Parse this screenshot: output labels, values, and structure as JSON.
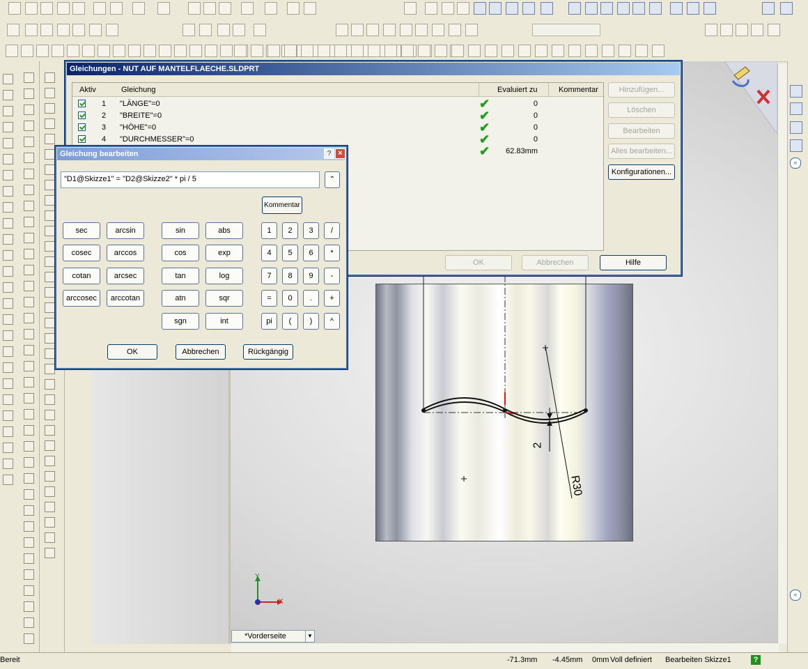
{
  "eq_dialog": {
    "title": "Gleichungen - NUT AUF MANTELFLAECHE.SLDPRT",
    "headers": {
      "active": "Aktiv",
      "equation": "Gleichung",
      "evaluated": "Evaluiert zu",
      "comment": "Kommentar"
    },
    "rows": [
      {
        "num": "1",
        "eq": "\"LÄNGE\"=0",
        "val": "0"
      },
      {
        "num": "2",
        "eq": "\"BREITE\"=0",
        "val": "0"
      },
      {
        "num": "3",
        "eq": "\"HÖHE\"=0",
        "val": "0"
      },
      {
        "num": "4",
        "eq": "\"DURCHMESSER\"=0",
        "val": "0"
      },
      {
        "num": "",
        "eq": "",
        "val": "62.83mm"
      }
    ],
    "buttons": {
      "add": "Hinzufügen...",
      "delete": "Löschen",
      "edit": "Bearbeiten",
      "edit_all": "Alles bearbeiten...",
      "configs": "Konfigurationen...",
      "ok": "OK",
      "cancel": "Abbrechen",
      "help": "Hilfe"
    }
  },
  "edit_dialog": {
    "title": "Gleichung bearbeiten",
    "help_btn": "?",
    "close_btn": "×",
    "expression": "\"D1@Skizze1\" = \"D2@Skizze2\" *  pi  / 5",
    "comment_btn": "Kommentar",
    "trig_col1": [
      "sec",
      "cosec",
      "cotan",
      "arccosec"
    ],
    "trig_col2": [
      "arcsin",
      "arccos",
      "arcsec",
      "arccotan"
    ],
    "func_col1": [
      "sin",
      "cos",
      "tan",
      "atn",
      "sgn"
    ],
    "func_col2": [
      "abs",
      "exp",
      "log",
      "sqr",
      "int"
    ],
    "keypad": [
      [
        "1",
        "2",
        "3",
        "/"
      ],
      [
        "4",
        "5",
        "6",
        "*"
      ],
      [
        "7",
        "8",
        "9",
        "-"
      ],
      [
        "=",
        "0",
        ".",
        "+"
      ],
      [
        "pi",
        "(",
        ")",
        "^"
      ]
    ],
    "ok": "OK",
    "cancel": "Abbrechen",
    "undo": "Rückgängig"
  },
  "sketch": {
    "dim_vertical": "2",
    "dim_radius": "R30",
    "axis_y": "Y",
    "axis_x": "X"
  },
  "view_selector": {
    "value": "*Vorderseite"
  },
  "statusbar": {
    "left": "Bereit",
    "x": "-71.3mm",
    "y": "-4.45mm",
    "z": "0mm",
    "state": "Voll definiert",
    "mode": "Bearbeiten Skizze1",
    "help": "?"
  },
  "colors": {
    "titlebar": "#0a246a",
    "titlebar_end": "#a6caf0",
    "accent_check": "#1f9d1f"
  }
}
